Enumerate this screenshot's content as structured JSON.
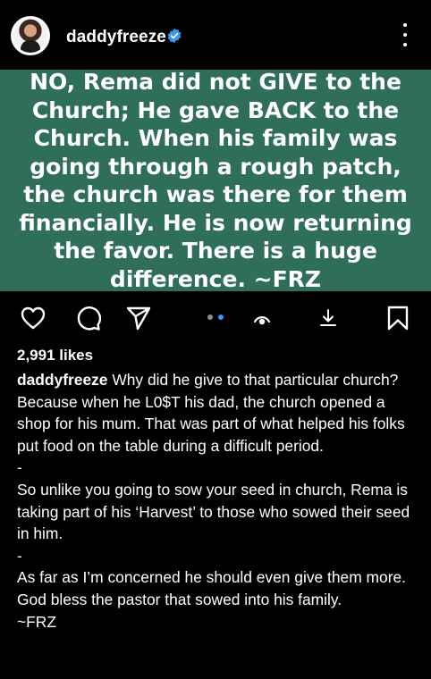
{
  "header": {
    "username": "daddyfreeze",
    "verified": true,
    "avatar_icon": "profile-photo",
    "more_icon": "vertical-ellipsis-icon"
  },
  "post": {
    "background_color": "#2f6f57",
    "text": "NO, Rema did not GIVE to the Church; He gave BACK to the Church. When his family was going through a rough patch, the church was there for them financially. He is now returning the favor. There is a huge difference. ~FRZ"
  },
  "actions": {
    "icons": [
      "heart-icon",
      "comment-icon",
      "share-icon",
      "reshare-icon",
      "download-icon",
      "bookmark-icon"
    ],
    "carousel": {
      "count": 2,
      "active": 2,
      "active_color": "#3897f0",
      "inactive_color": "#8e8e8e"
    }
  },
  "likes": "2,991 likes",
  "caption": {
    "author": "daddyfreeze",
    "lines": [
      "Why did he give to that particular church? Because when he L0$T his dad, the church opened a shop for his mum. That was part of what helped his folks put food on the table during a difficult period.",
      "-",
      "So unlike you going to sow your seed in church, Rema is taking part of his ‘Harvest’ to those who sowed their seed in him.",
      "-",
      "As far as I’m concerned he should even give them more. God bless the pastor that sowed into his family.",
      "~FRZ"
    ]
  }
}
